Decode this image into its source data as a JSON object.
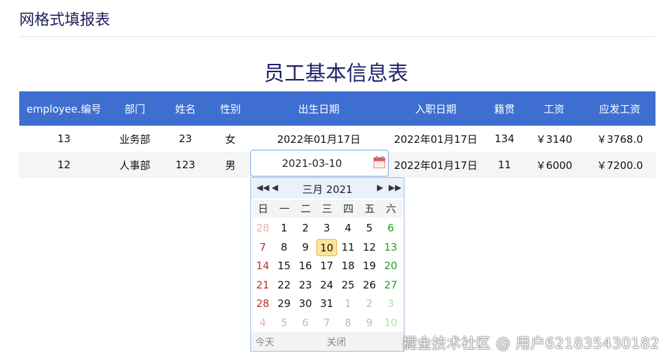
{
  "page": {
    "title": "网格式填报表"
  },
  "report": {
    "title": "员工基本信息表",
    "columns": [
      "employee.编号",
      "部门",
      "姓名",
      "性别",
      "出生日期",
      "入职日期",
      "籍贯",
      "工资",
      "应发工资"
    ],
    "rows": [
      [
        "13",
        "业务部",
        "23",
        "女",
        "2022年01月17日",
        "2022年01月17日",
        "134",
        "￥3140",
        "￥3768.0"
      ],
      [
        "12",
        "人事部",
        "123",
        "男",
        "",
        "2022年01月17日",
        "11",
        "￥6000",
        "￥7200.0"
      ]
    ]
  },
  "editor": {
    "value": "2021-03-10",
    "icon": "calendar-icon"
  },
  "datepicker": {
    "month_label": "三月 2021",
    "weekdays": [
      "日",
      "一",
      "二",
      "三",
      "四",
      "五",
      "六"
    ],
    "weeks": [
      [
        "28",
        "1",
        "2",
        "3",
        "4",
        "5",
        "6"
      ],
      [
        "7",
        "8",
        "9",
        "10",
        "11",
        "12",
        "13"
      ],
      [
        "14",
        "15",
        "16",
        "17",
        "18",
        "19",
        "20"
      ],
      [
        "21",
        "22",
        "23",
        "24",
        "25",
        "26",
        "27"
      ],
      [
        "28",
        "29",
        "30",
        "31",
        "1",
        "2",
        "3"
      ],
      [
        "4",
        "5",
        "6",
        "7",
        "8",
        "9",
        "10"
      ]
    ],
    "selected": "10",
    "today_label": "今天",
    "close_label": "关闭",
    "nav_icons": [
      "double-left-icon",
      "left-icon",
      "right-icon",
      "double-right-icon"
    ]
  },
  "colors": {
    "header_bg": "#3e6fd0",
    "selected_day": "#fde49a",
    "sunday": "#c62828",
    "saturday": "#1aa31a"
  },
  "watermark": "掘金技术社区 @ 用户621835430182"
}
